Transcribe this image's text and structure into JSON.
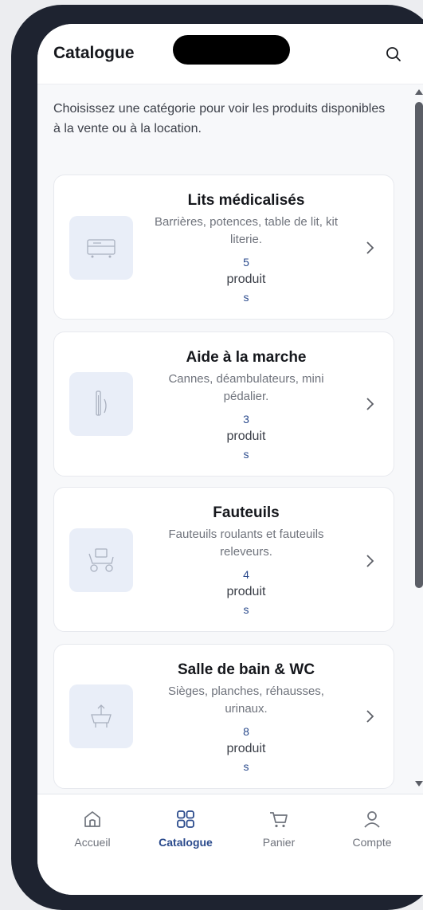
{
  "header": {
    "title": "Catalogue"
  },
  "intro": "Choisissez une catégorie pour voir les produits disponibles à la vente ou à la location.",
  "categories": [
    {
      "title": "Lits médicalisés",
      "desc": "Barrières, potences, table de lit, kit literie.",
      "count": "5",
      "unit_a": "produit",
      "unit_b": "s",
      "icon": "bed-icon"
    },
    {
      "title": "Aide à la marche",
      "desc": "Cannes, déambulateurs, mini pédalier.",
      "count": "3",
      "unit_a": "produit",
      "unit_b": "s",
      "icon": "walker-icon"
    },
    {
      "title": "Fauteuils",
      "desc": "Fauteuils roulants et fauteuils releveurs.",
      "count": "4",
      "unit_a": "produit",
      "unit_b": "s",
      "icon": "wheelchair-icon"
    },
    {
      "title": "Salle de bain & WC",
      "desc": "Sièges, planches, réhausses, urinaux.",
      "count": "8",
      "unit_a": "produit",
      "unit_b": "s",
      "icon": "bath-icon"
    }
  ],
  "tabs": [
    {
      "label": "Accueil",
      "icon": "home-icon"
    },
    {
      "label": "Catalogue",
      "icon": "grid-icon",
      "active": true
    },
    {
      "label": "Panier",
      "icon": "cart-icon"
    },
    {
      "label": "Compte",
      "icon": "user-icon"
    }
  ],
  "colors": {
    "accent": "#2a4a8c",
    "thumb_bg": "#e9eef8",
    "frame": "#1e2330"
  }
}
